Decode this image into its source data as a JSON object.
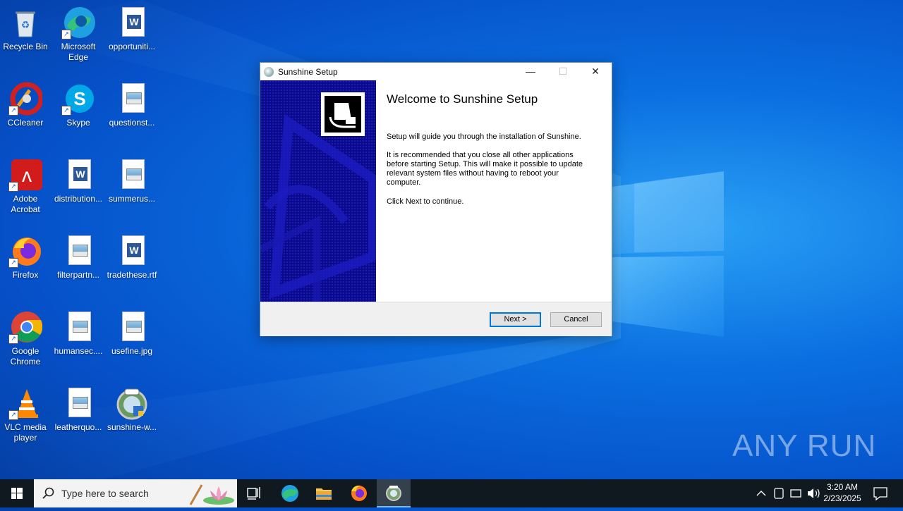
{
  "desktop": {
    "icons": [
      {
        "label": "Recycle Bin"
      },
      {
        "label": "Microsoft Edge"
      },
      {
        "label": "opportuniti..."
      },
      {
        "label": "CCleaner"
      },
      {
        "label": "Skype"
      },
      {
        "label": "questionst..."
      },
      {
        "label": "Adobe Acrobat"
      },
      {
        "label": "distribution..."
      },
      {
        "label": "summerus..."
      },
      {
        "label": "Firefox"
      },
      {
        "label": "filterpartn..."
      },
      {
        "label": "tradethese.rtf"
      },
      {
        "label": "Google Chrome"
      },
      {
        "label": "humansec...."
      },
      {
        "label": "usefine.jpg"
      },
      {
        "label": "VLC media player"
      },
      {
        "label": "leatherquo..."
      },
      {
        "label": "sunshine-w..."
      }
    ]
  },
  "dialog": {
    "title": "Sunshine Setup",
    "heading": "Welcome to Sunshine Setup",
    "para1": "Setup will guide you through the installation of Sunshine.",
    "para2": "It is recommended that you close all other applications before starting Setup. This will make it possible to update relevant system files without having to reboot your computer.",
    "para3": "Click Next to continue.",
    "next_label": "Next >",
    "cancel_label": "Cancel",
    "minimize_glyph": "—",
    "maximize_glyph": "☐",
    "close_glyph": "✕"
  },
  "taskbar": {
    "search_placeholder": "Type here to search",
    "time": "3:20 AM",
    "date": "2/23/2025",
    "pinned": [
      "task-view-icon",
      "edge-icon",
      "file-explorer-icon",
      "firefox-icon",
      "sunshine-setup-icon"
    ]
  },
  "watermark": "ANY RUN",
  "colors": {
    "desktop_blue": "#0a6fe0",
    "sidebar_navy": "#0a0a8c",
    "taskbar": "#101820",
    "default_button_border": "#0078d7"
  }
}
